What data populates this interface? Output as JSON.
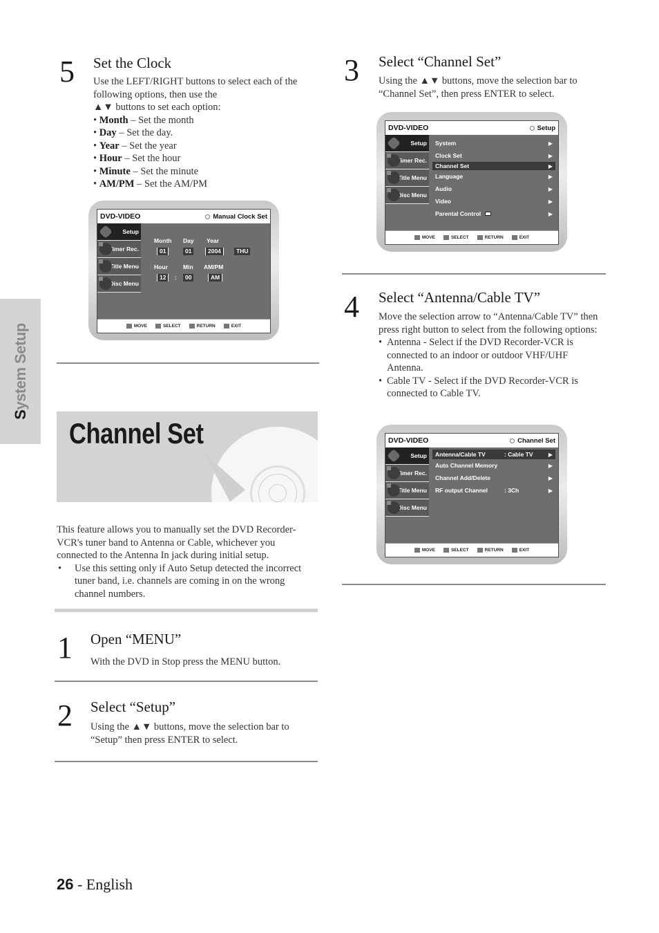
{
  "side_tab": {
    "first_letter": "S",
    "rest": "ystem Setup"
  },
  "step5": {
    "number": "5",
    "title": "Set the Clock",
    "intro": [
      "Use the LEFT/RIGHT buttons to select each of the",
      "following options, then use the",
      "▲▼ buttons to set each option:"
    ],
    "options": [
      {
        "term": "Month",
        "desc": " – Set the month"
      },
      {
        "term": "Day",
        "desc": " – Set the day."
      },
      {
        "term": "Year",
        "desc": " – Set the year"
      },
      {
        "term": "Hour",
        "desc": " – Set the hour"
      },
      {
        "term": "Minute",
        "desc": " – Set the minute"
      },
      {
        "term": "AM/PM",
        "desc": " – Set the AM/PM"
      }
    ]
  },
  "osd_common": {
    "brand": "DVD-VIDEO",
    "sidebar": [
      "Setup",
      "Timer Rec.",
      "Title Menu",
      "Disc Menu"
    ],
    "footer": [
      "MOVE",
      "SELECT",
      "RETURN",
      "EXIT"
    ]
  },
  "osd_clock": {
    "breadcrumb": "Manual Clock Set",
    "labels": {
      "month": "Month",
      "day": "Day",
      "year": "Year",
      "hour": "Hour",
      "min": "Min",
      "ampm": "AM/PM"
    },
    "values": {
      "month": "01",
      "day": "01",
      "year": "2004",
      "weekday": "THU",
      "hour": "12",
      "sep": ":",
      "min": "00",
      "ampm": "AM"
    }
  },
  "section": {
    "title": "Channel Set",
    "intro": "This feature allows you to manually set the DVD Recorder-VCR's tuner band to Antenna or Cable, whichever you connected to the Antenna In jack during initial setup.",
    "note": "Use this setting only if Auto Setup detected the incorrect tuner band, i.e. channels are coming in on the wrong channel numbers."
  },
  "step1": {
    "number": "1",
    "title": "Open “MENU”",
    "body": "With the DVD in Stop press the MENU button."
  },
  "step2": {
    "number": "2",
    "title": "Select “Setup”",
    "body": "Using the ▲▼  buttons, move the selection bar to “Setup” then press ENTER to select."
  },
  "step3": {
    "number": "3",
    "title": "Select “Channel Set”",
    "body": "Using the ▲▼ buttons, move the selection bar to “Channel Set”, then press ENTER to select."
  },
  "osd_setup": {
    "breadcrumb": "Setup",
    "items": [
      "System",
      "Clock Set",
      "Channel Set",
      "Language",
      "Audio",
      "Video",
      "Parental Control"
    ],
    "selected_index": 2
  },
  "step4": {
    "number": "4",
    "title": "Select “Antenna/Cable TV”",
    "body": "Move the selection arrow to “Antenna/Cable TV” then press right button to select from the following options:",
    "bullets": [
      "Antenna - Select if the DVD Recorder-VCR is connected to an indoor or outdoor VHF/UHF Antenna.",
      "Cable TV - Select if the DVD Recorder-VCR is connected to Cable TV."
    ]
  },
  "osd_channel": {
    "breadcrumb": "Channel Set",
    "items": [
      {
        "label": "Antenna/Cable TV",
        "value": ": Cable TV"
      },
      {
        "label": "Auto Channel Memory",
        "value": ""
      },
      {
        "label": "Channel Add/Delete",
        "value": ""
      },
      {
        "label": "RF output Channel",
        "value": ": 3Ch"
      }
    ],
    "selected_index": 0
  },
  "footer": {
    "page": "26",
    "lang": " - English"
  }
}
